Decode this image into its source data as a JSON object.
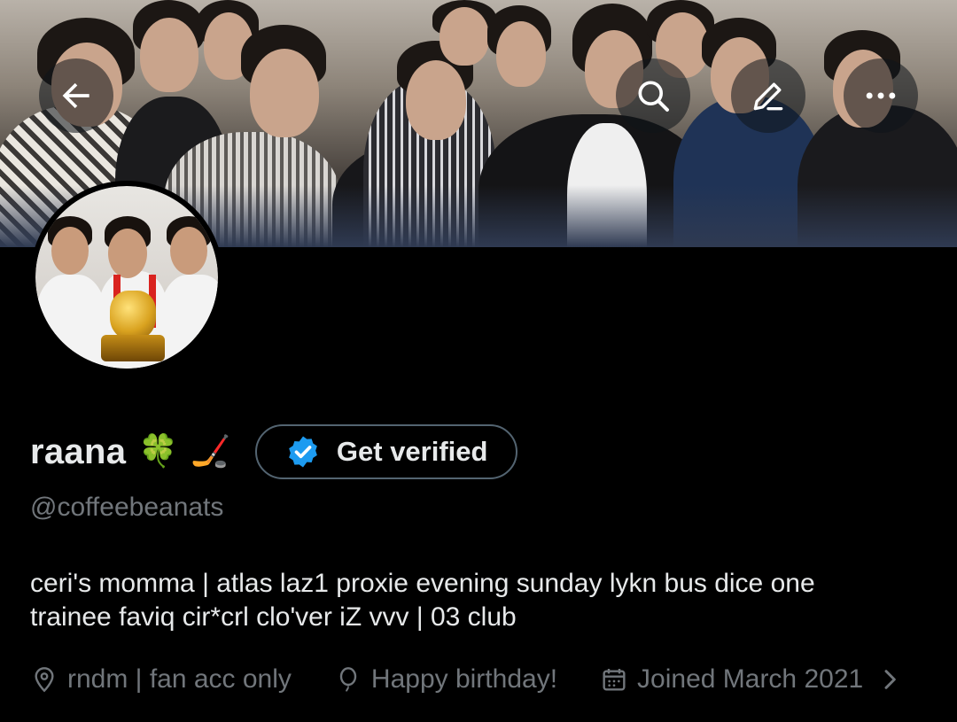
{
  "banner": {
    "back_icon": "back-arrow-icon",
    "search_icon": "search-icon",
    "edit_icon": "edit-pencil-icon",
    "more_icon": "more-dots-icon"
  },
  "profile": {
    "display_name": "raana",
    "name_emojis": [
      "🍀",
      "🏒"
    ],
    "get_verified_label": "Get verified",
    "handle": "@coffeebeanats",
    "bio_line1": "ceri's momma | atlas laz1 proxie evening sunday lykn bus dice one",
    "bio_line2": "trainee faviq cir*crl clo'ver iZ vvv | 03 club"
  },
  "meta": {
    "location": "rndm | fan acc only",
    "birthday": "Happy birthday!",
    "joined": "Joined March 2021"
  },
  "colors": {
    "background": "#000000",
    "primary_text": "#e7e9ea",
    "secondary_text": "#71767b",
    "border": "#536471",
    "verified_blue": "#1d9bf0"
  }
}
